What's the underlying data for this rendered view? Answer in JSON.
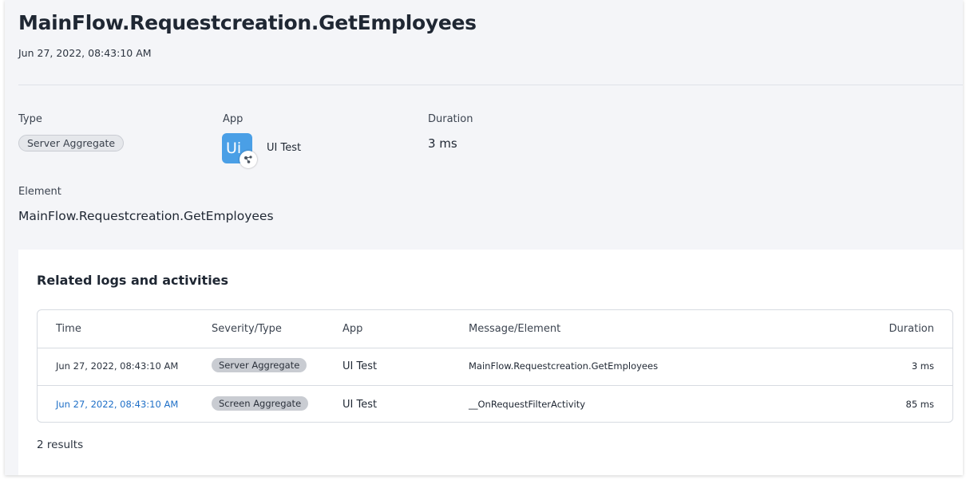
{
  "header": {
    "title": "MainFlow.Requestcreation.GetEmployees",
    "timestamp": "Jun 27, 2022, 08:43:10 AM"
  },
  "details": {
    "type_label": "Type",
    "type_value": "Server Aggregate",
    "app_label": "App",
    "app_icon_text": "Ui",
    "app_value": "UI Test",
    "duration_label": "Duration",
    "duration_value": "3 ms",
    "element_label": "Element",
    "element_value": "MainFlow.Requestcreation.GetEmployees"
  },
  "related": {
    "title": "Related logs and activities",
    "columns": {
      "time": "Time",
      "severity": "Severity/Type",
      "app": "App",
      "message": "Message/Element",
      "duration": "Duration"
    },
    "rows": [
      {
        "time": "Jun 27, 2022, 08:43:10 AM",
        "severity": "Server Aggregate",
        "app": "UI Test",
        "message": "MainFlow.Requestcreation.GetEmployees",
        "duration": "3 ms"
      },
      {
        "time": "Jun 27, 2022, 08:43:10 AM",
        "severity": "Screen Aggregate",
        "app": "UI Test",
        "message": "__OnRequestFilterActivity",
        "duration": "85 ms"
      }
    ],
    "results": "2 results"
  },
  "colors": {
    "panel_bg": "#f4f5f8",
    "app_icon_bg": "#4a9fe6",
    "link": "#1e6fc7",
    "badge_bg": "#c9ccd2"
  },
  "icons": {
    "app_icon": "ui-app-icon",
    "app_badge": "workflow-nodes-icon"
  }
}
